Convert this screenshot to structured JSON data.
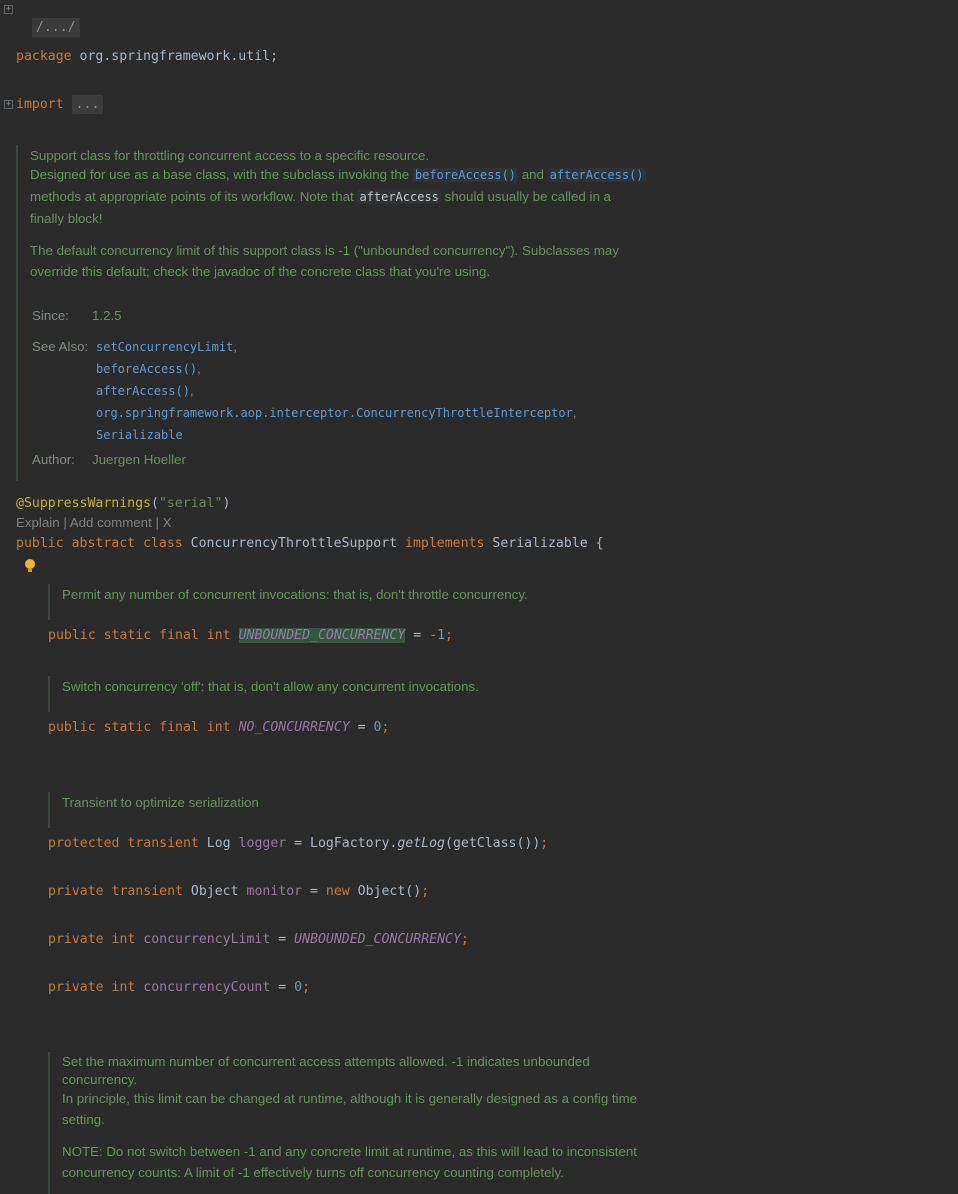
{
  "header": {
    "fold_path": "/.../",
    "package_kw": "package",
    "package_name": " org.springframework.util;",
    "import_kw": "import",
    "import_folded": "..."
  },
  "class_doc": {
    "line1": "Support class for throttling concurrent access to a specific resource.",
    "line2_a": "Designed for use as a base class, with the subclass invoking the ",
    "line2_code1": "beforeAccess()",
    "line2_and": " and ",
    "line2_code2": "afterAccess()",
    "line3_a": "methods at appropriate points of its workflow. Note that ",
    "line3_code": "afterAccess",
    "line3_b": " should usually be called in a",
    "line4": "finally block!",
    "para2_l1": "The default concurrency limit of this support class is -1 (\"unbounded concurrency\"). Subclasses may",
    "para2_l2": "override this default; check the javadoc of the concrete class that you're using.",
    "since_label": "Since:",
    "since_value": "1.2.5",
    "see_also_label": "See Also:",
    "see_also": [
      "setConcurrencyLimit",
      "beforeAccess()",
      "afterAccess()",
      "org.springframework.aop.interceptor.ConcurrencyThrottleInterceptor",
      "Serializable"
    ],
    "see_also_sep": ",",
    "author_label": "Author:",
    "author_value": "Juergen Hoeller"
  },
  "annotation": {
    "name": "@SuppressWarnings",
    "open": "(",
    "value": "\"serial\"",
    "close": ")"
  },
  "hint_bar": {
    "explain": "Explain",
    "sep1": " | ",
    "add_comment": "Add comment",
    "sep2": " | ",
    "close": "X"
  },
  "class_decl": {
    "modifiers": "public abstract class",
    "name": " ConcurrencyThrottleSupport ",
    "implements_kw": "implements",
    "interface": " Serializable {"
  },
  "fields": {
    "doc1": "Permit any number of concurrent invocations: that is, don't throttle concurrency.",
    "f1_mod": "public static final int ",
    "f1_name": "UNBOUNDED_CONCURRENCY",
    "f1_eq": " = ",
    "f1_val": "-1",
    "doc2": "Switch concurrency 'off': that is, don't allow any concurrent invocations.",
    "f2_mod": "public static final int ",
    "f2_name": "NO_CONCURRENCY",
    "f2_eq": " = ",
    "f2_val": "0",
    "doc3": "Transient to optimize serialization",
    "f3_mod": "protected transient ",
    "f3_type": "Log ",
    "f3_name": "logger",
    "f3_eq": " = LogFactory.",
    "f3_call": "getLog",
    "f3_rest": "(getClass())",
    "f4_mod": "private transient ",
    "f4_type": "Object ",
    "f4_name": "monitor",
    "f4_eq": " = ",
    "f4_new": "new ",
    "f4_rest": "Object()",
    "f5_mod": "private int ",
    "f5_name": "concurrencyLimit",
    "f5_eq": " = ",
    "f5_val": "UNBOUNDED_CONCURRENCY",
    "f6_mod": "private int ",
    "f6_name": "concurrencyCount",
    "f6_eq": " = ",
    "f6_val": "0",
    "semicolon": ";"
  },
  "method_doc": {
    "l1": "Set the maximum number of concurrent access attempts allowed. -1 indicates unbounded",
    "l2": "concurrency.",
    "l3": "In principle, this limit can be changed at runtime, although it is generally designed as a config time",
    "l4": "setting.",
    "l5": "NOTE: Do not switch between -1 and any concrete limit at runtime, as this will lead to inconsistent",
    "l6": "concurrency counts: A limit of -1 effectively turns off concurrency counting completely."
  }
}
